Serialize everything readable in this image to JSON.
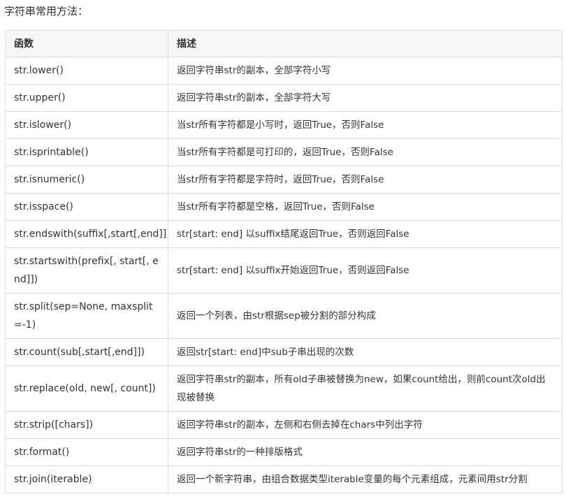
{
  "heading": "字符串常用方法：",
  "table": {
    "headers": [
      "函数",
      "描述"
    ],
    "rows": [
      {
        "fn": "str.lower()",
        "desc": "返回字符串str的副本，全部字符小写"
      },
      {
        "fn": "str.upper()",
        "desc": "返回字符串str的副本，全部字符大写"
      },
      {
        "fn": "str.islower()",
        "desc": "当str所有字符都是小写时，返回True，否则False"
      },
      {
        "fn": "str.isprintable()",
        "desc": "当str所有字符都是可打印的，返回True，否则False"
      },
      {
        "fn": "str.isnumeric()",
        "desc": "当str所有字符都是字符时，返回True，否则False"
      },
      {
        "fn": "str.isspace()",
        "desc": "当str所有字符都是空格，返回True，否则False"
      },
      {
        "fn": "str.endswith(suffix[,start[,end]])",
        "desc": "str[start: end] 以suffix结尾返回True，否则返回False"
      },
      {
        "fn": "str.startswith(prefix[, start[, end]])",
        "desc": "str[start: end] 以suffix开始返回True，否则返回False"
      },
      {
        "fn": "str.split(sep=None, maxsplit=-1)",
        "desc": "返回一个列表，由str根据sep被分割的部分构成"
      },
      {
        "fn": "str.count(sub[,start[,end]])",
        "desc": "返回str[start: end]中sub子串出现的次数"
      },
      {
        "fn": "str.replace(old, new[, count])",
        "desc": "返回字符串str的副本，所有old子串被替换为new，如果count给出，则前count次old出现被替换"
      },
      {
        "fn": "str.strip([chars])",
        "desc": "返回字符串str的副本，左侧和右侧去掉在chars中列出字符"
      },
      {
        "fn": "str.format()",
        "desc": "返回字符串str的一种排版格式"
      },
      {
        "fn": "str.join(iterable)",
        "desc": "返回一个新字符串，由组合数据类型iterable变量的每个元素组成，元素间用str分割"
      }
    ]
  }
}
